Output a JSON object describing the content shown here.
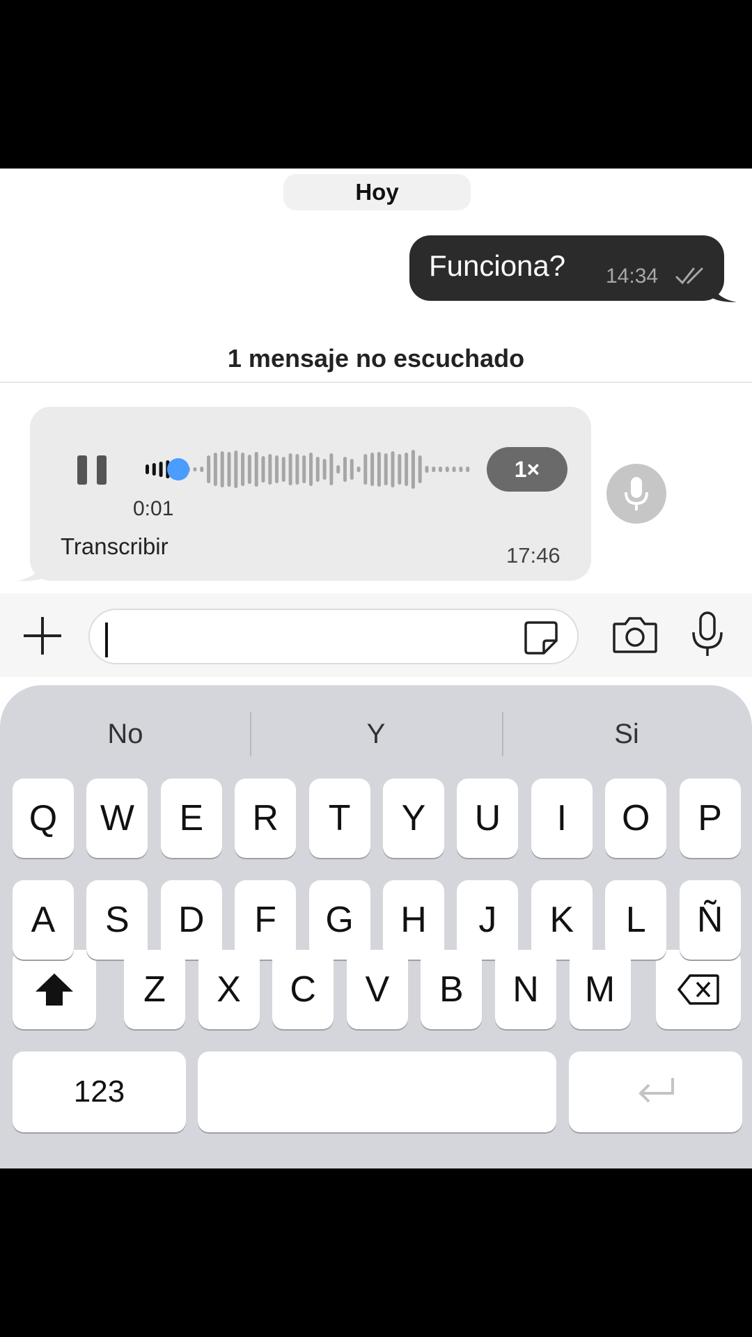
{
  "chat": {
    "date_chip": "Hoy",
    "outgoing": {
      "text": "Funciona?",
      "time": "14:34"
    },
    "unread_banner": "1 mensaje no escuchado",
    "voice_message": {
      "elapsed": "0:01",
      "speed": "1×",
      "transcribe_label": "Transcribir",
      "time": "17:46",
      "progress": 0.1
    }
  },
  "composer": {
    "input_value": ""
  },
  "keyboard": {
    "suggestions": [
      "No",
      "Y",
      "Si"
    ],
    "row1": [
      "Q",
      "W",
      "E",
      "R",
      "T",
      "Y",
      "U",
      "I",
      "O",
      "P"
    ],
    "row2": [
      "A",
      "S",
      "D",
      "F",
      "G",
      "H",
      "J",
      "K",
      "L",
      "Ñ"
    ],
    "row3": [
      "Z",
      "X",
      "C",
      "V",
      "B",
      "N",
      "M"
    ],
    "numbers_key": "123"
  },
  "colors": {
    "accent": "#4a9cff",
    "outgoing_bubble": "#2b2b2b",
    "incoming_bubble": "#ebebeb",
    "keyboard_bg": "#d4d6db"
  }
}
